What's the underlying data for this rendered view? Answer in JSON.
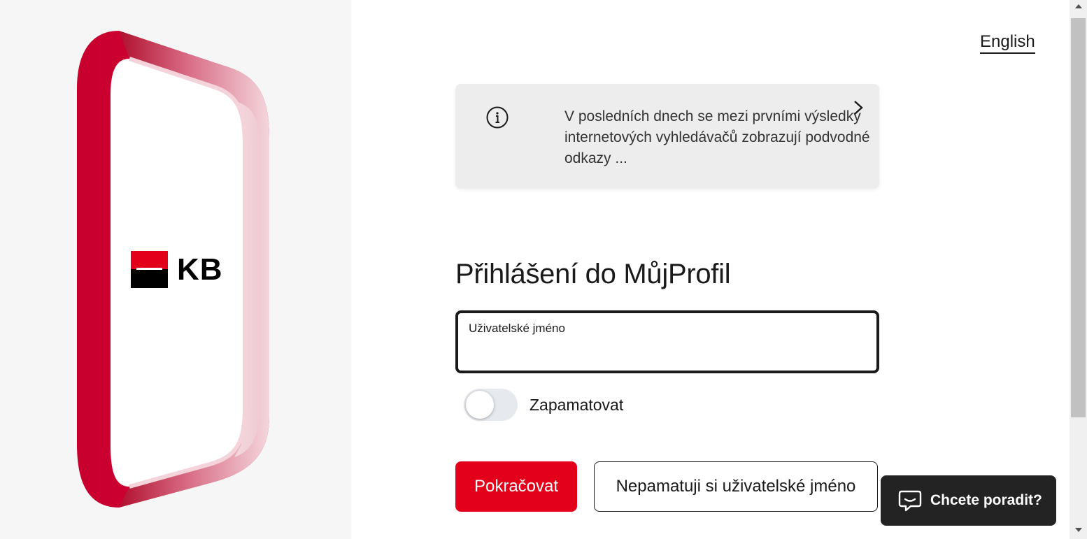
{
  "language_switch": {
    "label": "English"
  },
  "notice": {
    "icon": "info-icon",
    "message": "V posledních dnech se mezi prvními výsledky internetových vyhledávačů zobrazují podvodné odkazy ...",
    "chevron": "chevron-right-icon"
  },
  "brand": {
    "logo_text": "KB",
    "accent_color": "#e2001a"
  },
  "login": {
    "title": "Přihlášení do MůjProfil",
    "username_label": "Uživatelské jméno",
    "username_value": "",
    "remember_label": "Zapamatovat",
    "remember_enabled": false,
    "continue_label": "Pokračovat",
    "forgot_label": "Nepamatuji si uživatelské jméno"
  },
  "chat": {
    "label": "Chcete poradit?",
    "icon": "chat-icon"
  },
  "colors": {
    "primary": "#e2001a",
    "dark": "#232323",
    "notice_bg": "#ededed"
  }
}
